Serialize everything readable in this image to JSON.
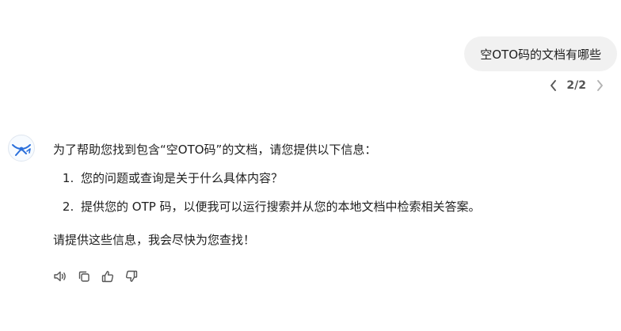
{
  "user_message": {
    "text": "空OTO码的文档有哪些"
  },
  "pager": {
    "current": "2/2"
  },
  "assistant": {
    "intro": "为了帮助您找到包含“空OTO码”的文档，请您提供以下信息：",
    "list": [
      "您的问题或查询是关于什么具体内容？",
      "提供您的 OTP 码，以便我可以运行搜索并从您的本地文档中检索相关答案。"
    ],
    "closing": "请提供这些信息，我会尽快为您查找！"
  },
  "icons": {
    "speaker": "speaker-icon",
    "copy": "copy-icon",
    "thumbs_up": "thumbs-up-icon",
    "thumbs_down": "thumbs-down-icon",
    "prev": "chevron-left-icon",
    "next": "chevron-right-icon"
  },
  "colors": {
    "bubble_bg": "#f1f1f1",
    "text": "#1f1f1f",
    "icon": "#555555",
    "avatar_accent": "#2a6fdb"
  }
}
